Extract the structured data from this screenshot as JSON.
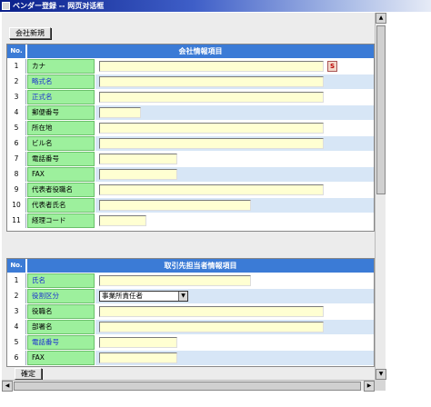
{
  "window": {
    "title": "ベンダー登録 -- 网页对话框"
  },
  "toolbar": {
    "new_company_label": "会社新規",
    "confirm_label": "確定"
  },
  "company_section": {
    "no_header": "No.",
    "title": "会社情報項目",
    "kana_button": "S",
    "rows": [
      {
        "no": "1",
        "label": "カナ"
      },
      {
        "no": "2",
        "label": "略式名"
      },
      {
        "no": "3",
        "label": "正式名"
      },
      {
        "no": "4",
        "label": "郵便番号"
      },
      {
        "no": "5",
        "label": "所在地"
      },
      {
        "no": "6",
        "label": "ビル名"
      },
      {
        "no": "7",
        "label": "電話番号"
      },
      {
        "no": "8",
        "label": "FAX"
      },
      {
        "no": "9",
        "label": "代表者役職名"
      },
      {
        "no": "10",
        "label": "代表者氏名"
      },
      {
        "no": "11",
        "label": "経理コード"
      }
    ]
  },
  "contact_section": {
    "no_header": "No.",
    "title": "取引先担当者情報項目",
    "role_select": {
      "selected": "事業所責任者"
    },
    "rows": [
      {
        "no": "1",
        "label": "氏名"
      },
      {
        "no": "2",
        "label": "役割区分"
      },
      {
        "no": "3",
        "label": "役職名"
      },
      {
        "no": "4",
        "label": "部署名"
      },
      {
        "no": "5",
        "label": "電話番号"
      },
      {
        "no": "6",
        "label": "FAX"
      }
    ]
  },
  "icons": {
    "scroll_up": "▲",
    "scroll_down": "▼",
    "scroll_left": "◀",
    "scroll_right": "▶",
    "dropdown": "▼"
  },
  "colors": {
    "header_blue": "#3b7bd6",
    "label_green": "#9df09d",
    "field_yellow": "#ffffd2"
  }
}
